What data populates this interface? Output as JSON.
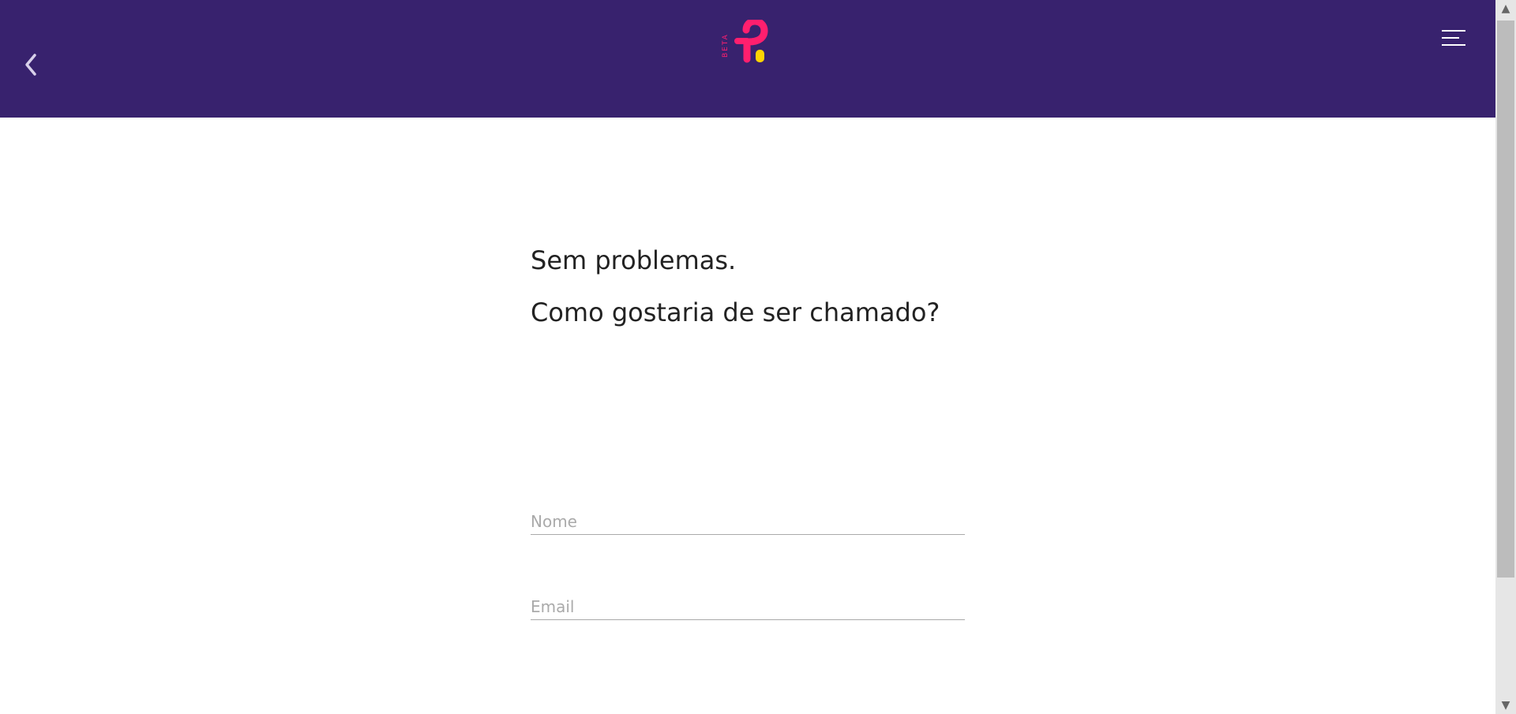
{
  "header": {
    "logo_badge": "BETA",
    "colors": {
      "background": "#38226e",
      "logo_pink": "#ff1f6e",
      "logo_yellow": "#ffd400"
    }
  },
  "main": {
    "line1": "Sem problemas.",
    "line2": "Como gostaria de ser chamado?"
  },
  "form": {
    "name_placeholder": "Nome",
    "email_placeholder": "Email"
  },
  "scrollbar": {
    "up": "▲",
    "down": "▼"
  }
}
